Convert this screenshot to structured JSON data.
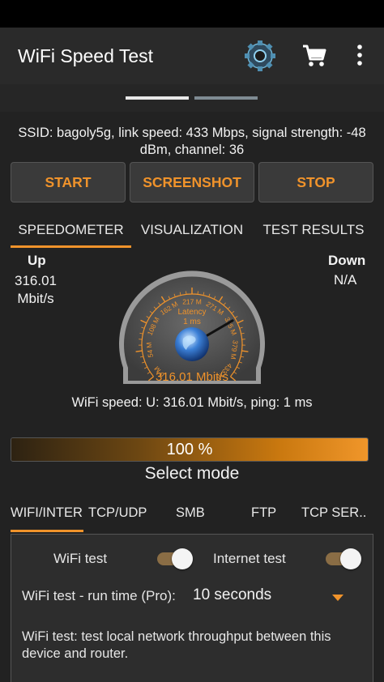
{
  "app": {
    "title": "WiFi Speed Test"
  },
  "info": {
    "ssid_line": "SSID: bagoly5g, link speed: 433 Mbps, signal strength: -48 dBm, channel: 36"
  },
  "buttons": {
    "start": "START",
    "screenshot": "SCREENSHOT",
    "stop": "STOP"
  },
  "tabs": [
    "SPEEDOMETER",
    "VISUALIZATION",
    "TEST RESULTS"
  ],
  "up": {
    "label": "Up",
    "value": "316.01",
    "unit": "Mbit/s"
  },
  "down": {
    "label": "Down",
    "value": "N/A"
  },
  "gauge": {
    "ticks": [
      "0 M",
      "54 M",
      "108 M",
      "162 M",
      "217 M",
      "271 M",
      "325 M",
      "379 M",
      "433 M"
    ],
    "latency_label": "Latency",
    "latency_value": "1 ms",
    "speed_readout": "316.01 Mbit/s",
    "needle_value": 316.01,
    "max": 433,
    "accent": "#f0932b"
  },
  "summary": "WiFi speed: U: 316.01 Mbit/s, ping: 1 ms",
  "progress": {
    "label": "100 %",
    "fraction": 1.0
  },
  "mode": {
    "title": "Select mode",
    "tabs": [
      "WIFI/INTERNET",
      "TCP/UDP",
      "SMB",
      "FTP",
      "TCP SER.."
    ]
  },
  "panel": {
    "wifi_test_label": "WiFi test",
    "internet_test_label": "Internet test",
    "runtime_label": "WiFi test - run time (Pro):",
    "runtime_value": "10 seconds",
    "description": "WiFi test: test local network throughput between this device and router."
  },
  "icons": {
    "gear": "gear-icon",
    "cart": "cart-icon",
    "menu": "more-vert-icon",
    "globe": "globe-icon"
  },
  "colors": {
    "accent": "#f0932b",
    "background": "#222222",
    "appbar": "#2a2a2a"
  }
}
